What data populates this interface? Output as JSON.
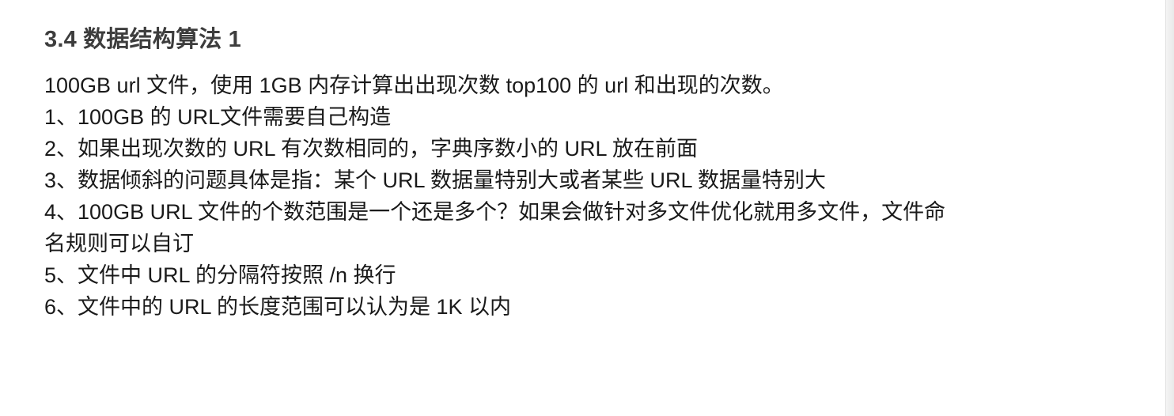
{
  "section": {
    "title": "3.4 数据结构算法 1"
  },
  "problem": {
    "intro": "100GB url 文件，使用 1GB 内存计算出出现次数 top100 的 url 和出现的次数。",
    "items": [
      "1、100GB 的 URL文件需要自己构造",
      "2、如果出现次数的 URL 有次数相同的，字典序数小的 URL 放在前面",
      "3、数据倾斜的问题具体是指：某个 URL 数据量特别大或者某些 URL 数据量特别大",
      "4、100GB URL 文件的个数范围是一个还是多个？如果会做针对多文件优化就用多文件，文件命",
      "名规则可以自订",
      "5、文件中 URL 的分隔符按照 /n 换行",
      "6、文件中的 URL 的长度范围可以认为是 1K 以内"
    ]
  }
}
